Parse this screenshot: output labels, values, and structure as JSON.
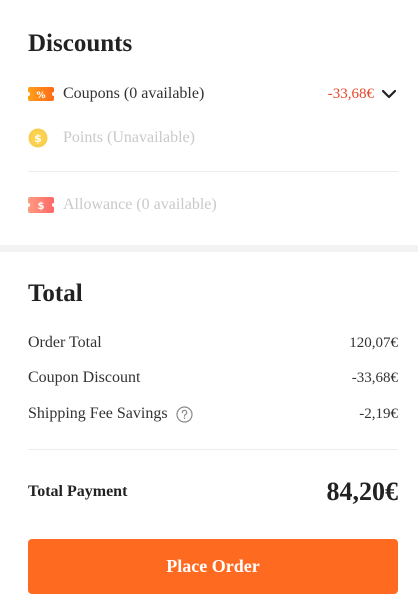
{
  "discounts": {
    "title": "Discounts",
    "coupons": {
      "label": "Coupons (0 available)",
      "value": "-33,68€",
      "icon": "coupon-percent-icon",
      "icon_text": "%",
      "icon_color": "#ff7a1a",
      "expand_icon": "chevron-down-icon"
    },
    "points": {
      "label": "Points (Unavailable)",
      "icon": "coin-icon",
      "icon_text": "$",
      "icon_color": "#f7c62f"
    },
    "allowance": {
      "label": "Allowance (0 available)",
      "icon": "allowance-ticket-icon",
      "icon_text": "$",
      "icon_color": "#ff5c4d"
    }
  },
  "total": {
    "title": "Total",
    "rows": [
      {
        "label": "Order Total",
        "amount": "120,07€"
      },
      {
        "label": "Coupon Discount",
        "amount": "-33,68€"
      },
      {
        "label": "Shipping Fee Savings",
        "amount": "-2,19€",
        "help_icon": "question-circle-icon"
      }
    ],
    "payment_label": "Total Payment",
    "payment_amount": "84,20€"
  },
  "actions": {
    "place_order_label": "Place Order",
    "accent_color": "#ff6a21"
  },
  "colors": {
    "discount_red": "#e8472a",
    "muted_text": "#c9c9c9"
  }
}
